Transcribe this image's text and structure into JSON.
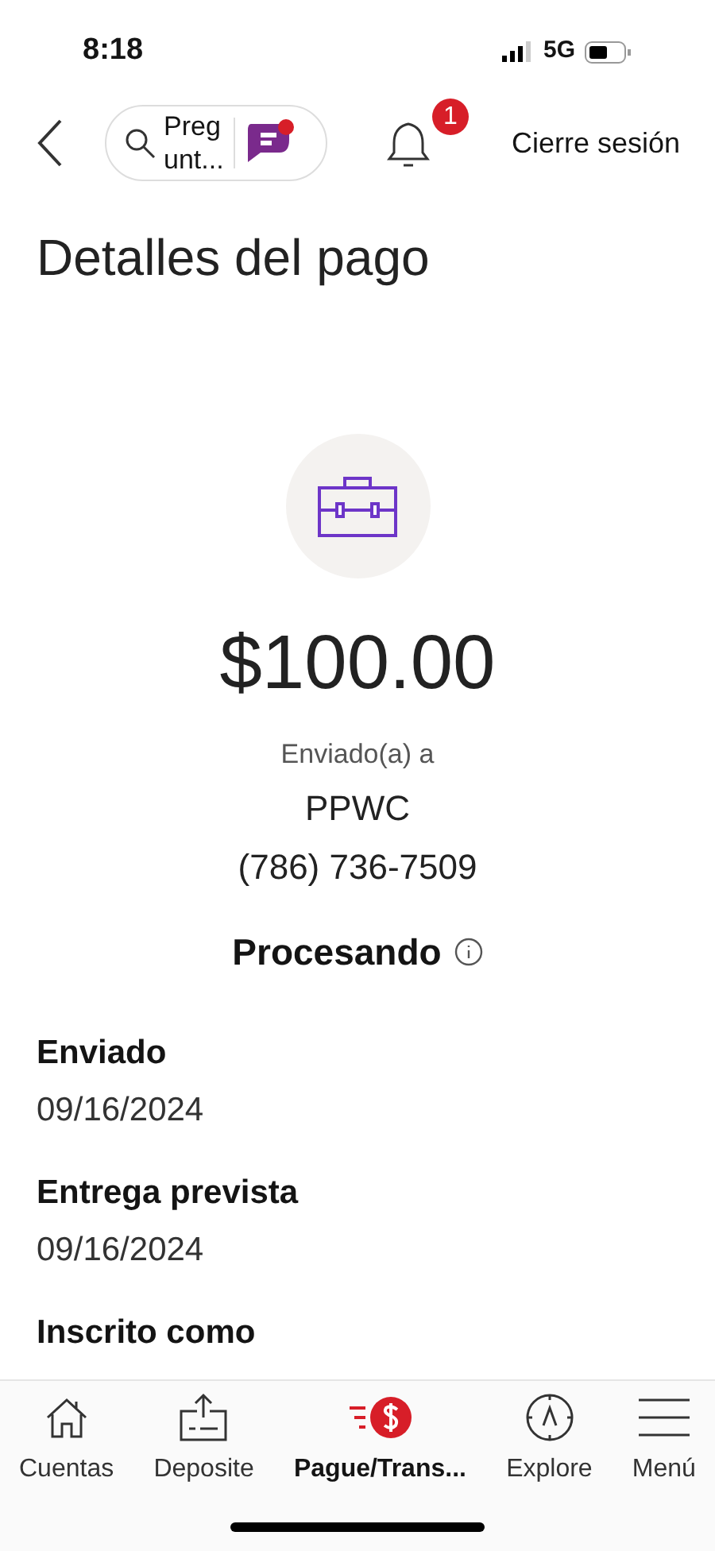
{
  "status_bar": {
    "time": "8:18",
    "network": "5G"
  },
  "header": {
    "search_label": "Preg unt...",
    "notification_count": "1",
    "logout": "Cierre sesión"
  },
  "title": "Detalles del pago",
  "payment": {
    "amount": "$100.00",
    "sent_to_label": "Enviado(a) a",
    "recipient": "PPWC",
    "phone": "(786) 736-7509",
    "status": "Procesando"
  },
  "details": [
    {
      "label": "Enviado",
      "value": "09/16/2024"
    },
    {
      "label": "Entrega prevista",
      "value": "09/16/2024"
    },
    {
      "label": "Inscrito como"
    }
  ],
  "tabs": [
    {
      "kind": "home",
      "label": "Cuentas",
      "selected": false
    },
    {
      "kind": "deposit",
      "label": "Deposite",
      "selected": false
    },
    {
      "kind": "pay",
      "label": "Pague/Trans...",
      "selected": true
    },
    {
      "kind": "explore",
      "label": "Explore",
      "selected": false
    },
    {
      "kind": "menu",
      "label": "Menú",
      "selected": false
    }
  ]
}
